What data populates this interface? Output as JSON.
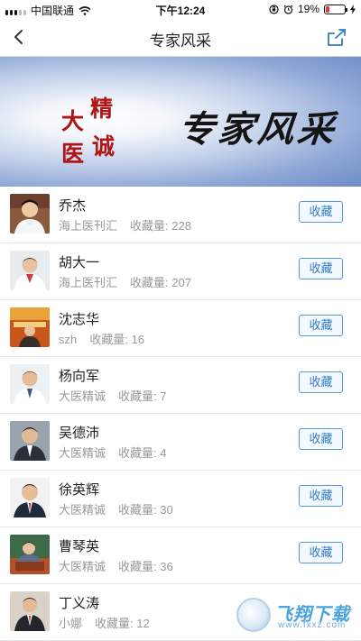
{
  "status_bar": {
    "carrier": "中国联通",
    "time": "下午12:24",
    "battery_percent": "19%",
    "battery_level": 0.19
  },
  "nav": {
    "title": "专家风采",
    "back_icon": "chevron-left-icon",
    "share_icon": "share-icon"
  },
  "banner": {
    "motto_chars": [
      "大",
      "精",
      "医",
      "诚"
    ],
    "headline": "专家风采"
  },
  "labels": {
    "count_prefix": "收藏量: ",
    "fav_button": "收藏"
  },
  "experts": [
    {
      "name": "乔杰",
      "source": "海上医刊汇",
      "count": "228"
    },
    {
      "name": "胡大一",
      "source": "海上医刊汇",
      "count": "207"
    },
    {
      "name": "沈志华",
      "source": "szh",
      "count": "16"
    },
    {
      "name": "杨向军",
      "source": "大医精诚",
      "count": "7"
    },
    {
      "name": "吴德沛",
      "source": "大医精诚",
      "count": "4"
    },
    {
      "name": "徐英辉",
      "source": "大医精诚",
      "count": "30"
    },
    {
      "name": "曹琴英",
      "source": "大医精诚",
      "count": "36"
    },
    {
      "name": "丁义涛",
      "source": "小娜",
      "count": "12"
    }
  ],
  "watermark": {
    "main": "飞翔下载",
    "sub": "www.fxxz.com"
  },
  "colors": {
    "accent": "#2f7bc6",
    "banner_motto": "#b01414"
  }
}
